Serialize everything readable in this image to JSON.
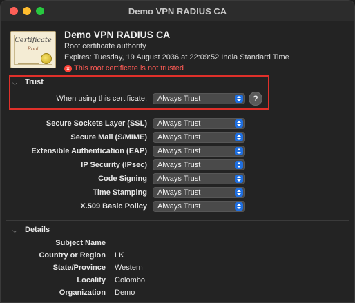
{
  "window": {
    "title": "Demo VPN RADIUS CA"
  },
  "certificate": {
    "icon_word": "Certificate",
    "icon_sub": "Root",
    "name": "Demo VPN RADIUS CA",
    "kind": "Root certificate authority",
    "expires": "Expires: Tuesday, 19 August 2036 at 22:09:52 India Standard Time",
    "warning": "This root certificate is not trusted",
    "warning_color": "#ff5b55"
  },
  "trust": {
    "section_label": "Trust",
    "when_using_label": "When using this certificate:",
    "when_using_value": "Always Trust",
    "help_glyph": "?",
    "rows": [
      {
        "label": "Secure Sockets Layer (SSL)",
        "value": "Always Trust"
      },
      {
        "label": "Secure Mail (S/MIME)",
        "value": "Always Trust"
      },
      {
        "label": "Extensible Authentication (EAP)",
        "value": "Always Trust"
      },
      {
        "label": "IP Security (IPsec)",
        "value": "Always Trust"
      },
      {
        "label": "Code Signing",
        "value": "Always Trust"
      },
      {
        "label": "Time Stamping",
        "value": "Always Trust"
      },
      {
        "label": "X.509 Basic Policy",
        "value": "Always Trust"
      }
    ]
  },
  "details": {
    "section_label": "Details",
    "subject_name_label": "Subject Name",
    "fields": [
      {
        "label": "Country or Region",
        "value": "LK"
      },
      {
        "label": "State/Province",
        "value": "Western"
      },
      {
        "label": "Locality",
        "value": "Colombo"
      },
      {
        "label": "Organization",
        "value": "Demo"
      }
    ]
  },
  "colors": {
    "accent": "#1f6fe0",
    "highlight_border": "#e0302a"
  }
}
